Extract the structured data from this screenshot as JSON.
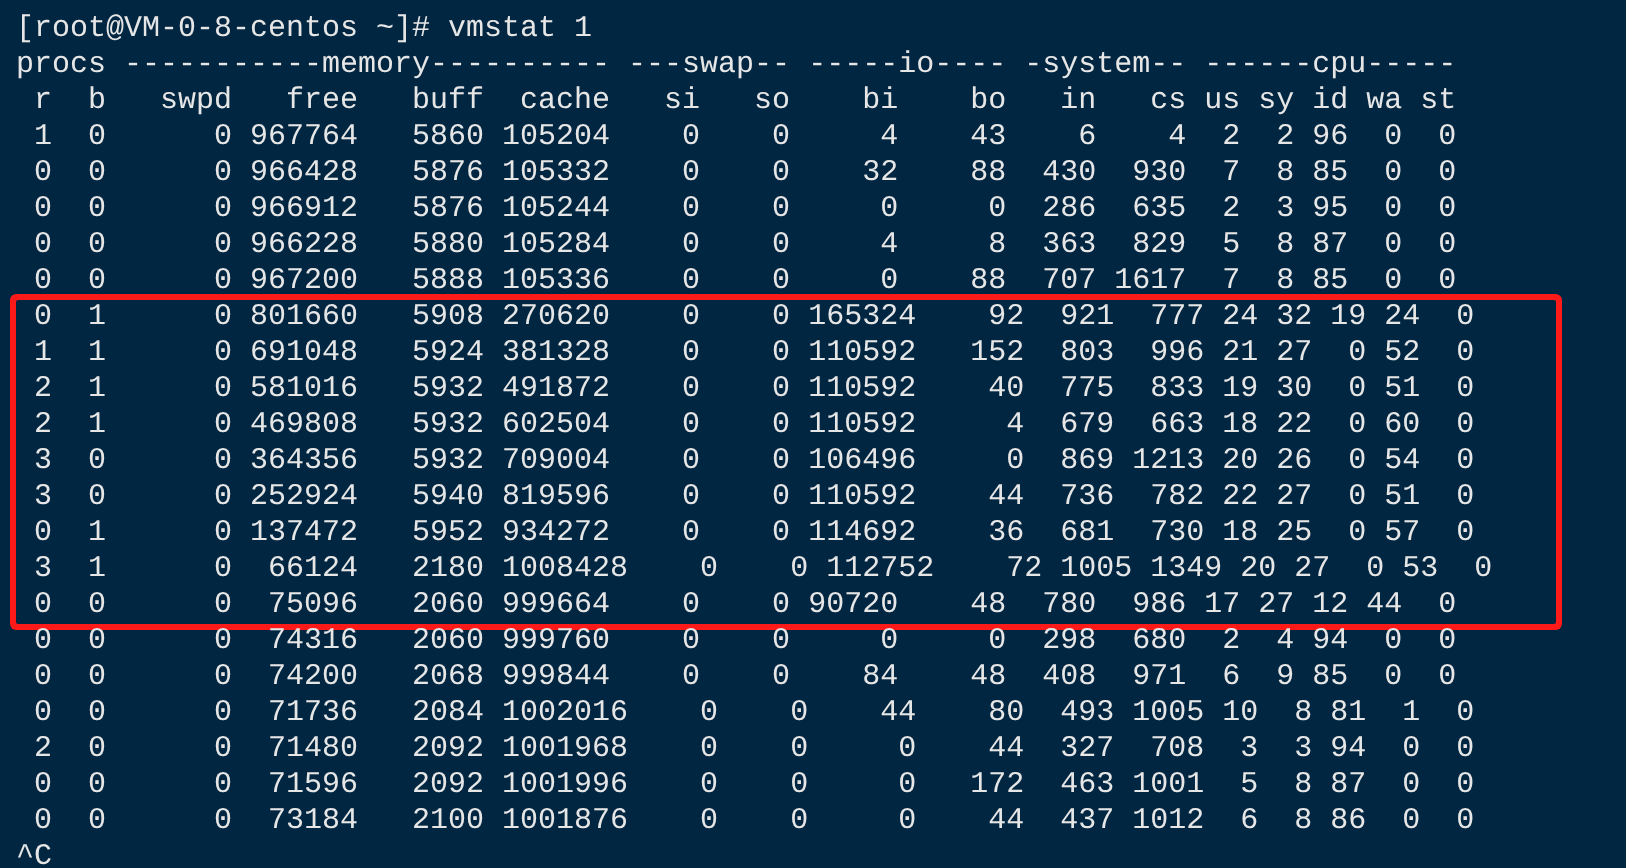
{
  "terminal": {
    "prompt": "[root@VM-0-8-centos ~]# vmstat 1",
    "header_lines": [
      "procs -----------memory---------- ---swap-- -----io---- -system-- ------cpu-----",
      " r  b   swpd   free   buff  cache   si   so    bi    bo   in   cs us sy id wa st"
    ],
    "blocks": [
      {
        "highlighted": false,
        "rows": [
          " 1  0      0 967764   5860 105204    0    0     4    43    6    4  2  2 96  0  0",
          " 0  0      0 966428   5876 105332    0    0    32    88  430  930  7  8 85  0  0",
          " 0  0      0 966912   5876 105244    0    0     0     0  286  635  2  3 95  0  0",
          " 0  0      0 966228   5880 105284    0    0     4     8  363  829  5  8 87  0  0",
          " 0  0      0 967200   5888 105336    0    0     0    88  707 1617  7  8 85  0  0"
        ]
      },
      {
        "highlighted": true,
        "rows": [
          " 0  1      0 801660   5908 270620    0    0 165324    92  921  777 24 32 19 24  0",
          " 1  1      0 691048   5924 381328    0    0 110592   152  803  996 21 27  0 52  0",
          " 2  1      0 581016   5932 491872    0    0 110592    40  775  833 19 30  0 51  0",
          " 2  1      0 469808   5932 602504    0    0 110592     4  679  663 18 22  0 60  0",
          " 3  0      0 364356   5932 709004    0    0 106496     0  869 1213 20 26  0 54  0",
          " 3  0      0 252924   5940 819596    0    0 110592    44  736  782 22 27  0 51  0",
          " 0  1      0 137472   5952 934272    0    0 114692    36  681  730 18 25  0 57  0",
          " 3  1      0  66124   2180 1008428    0    0 112752    72 1005 1349 20 27  0 53  0",
          " 0  0      0  75096   2060 999664    0    0 90720    48  780  986 17 27 12 44  0"
        ]
      },
      {
        "highlighted": false,
        "rows": [
          " 0  0      0  74316   2060 999760    0    0     0     0  298  680  2  4 94  0  0",
          " 0  0      0  74200   2068 999844    0    0    84    48  408  971  6  9 85  0  0",
          " 0  0      0  71736   2084 1002016    0    0    44    80  493 1005 10  8 81  1  0",
          " 2  0      0  71480   2092 1001968    0    0     0    44  327  708  3  3 94  0  0",
          " 0  0      0  71596   2092 1001996    0    0     0   172  463 1001  5  8 87  0  0",
          " 0  0      0  73184   2100 1001876    0    0     0    44  437 1012  6  8 86  0  0"
        ]
      }
    ],
    "interrupt": "^C"
  }
}
